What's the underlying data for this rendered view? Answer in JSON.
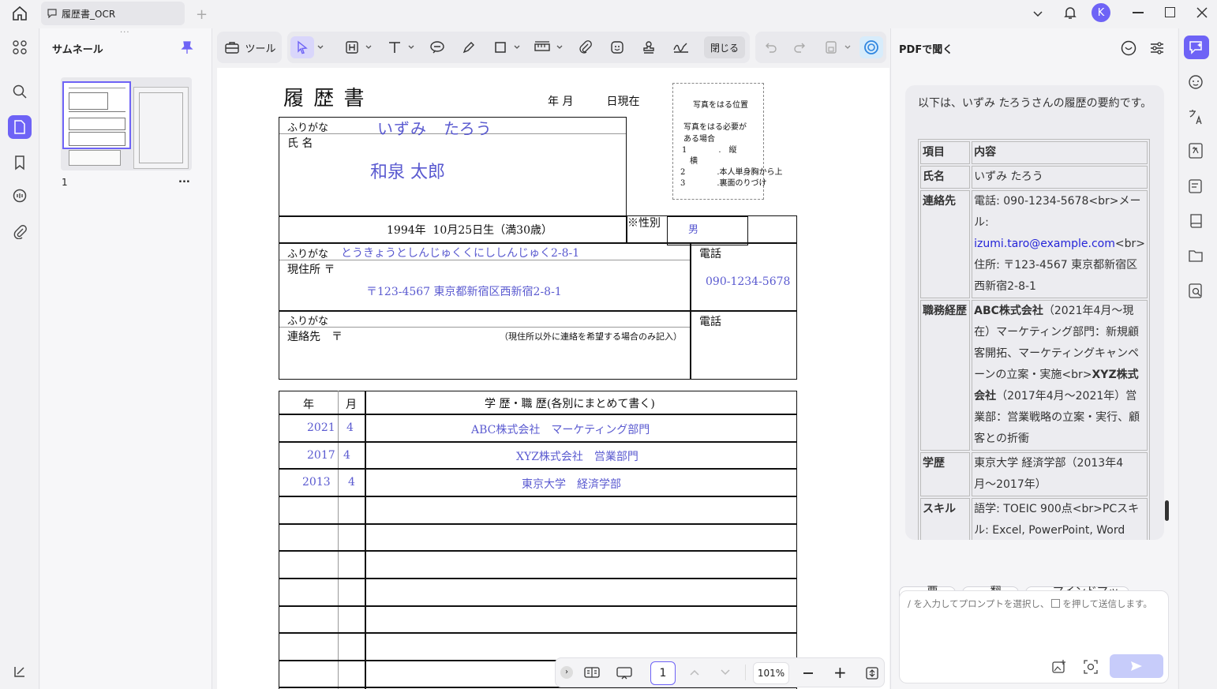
{
  "window": {
    "tab_title": "履歴書_OCR",
    "user_initial": "K",
    "accent": "#6e63f6"
  },
  "thumbnails": {
    "title": "サムネール",
    "page_number": "1",
    "more": "..."
  },
  "toolbar": {
    "tools_label": "ツール",
    "close_label": "閉じる"
  },
  "document": {
    "title": "履 歴 書",
    "date_label": "年 月　　　日現在",
    "photo": {
      "line1": "写真をはる位置",
      "line2": "写真をはる必要が",
      "line3": "ある場合",
      "line4": "1　　　　.　縦",
      "line5": "　横",
      "line6": "2　　　　.本人単身胸から上",
      "line7": "3　　　　.裏面のりづけ"
    },
    "furigana_label": "ふりがな",
    "furigana_name": "いずみ　たろう",
    "name_label": "氏 名",
    "name": "和泉 太郎",
    "birth": "1994年  10月25日生（満30歳）",
    "gender_label": "※性別",
    "gender": "男",
    "address_furigana_label": "ふりがな",
    "address_furigana": "とうきょうとしんじゅくくにししんじゅく2-8-1",
    "address_label": "現住所 〒",
    "address": "〒123-4567 東京都新宿区西新宿2-8-1",
    "phone_label": "電話",
    "phone": "090-1234-5678",
    "contact_furigana_label": "ふりがな",
    "contact_label": "連絡先　〒",
    "contact_note": "（現住所以外に連絡を希望する場合のみ記入）",
    "contact_phone_label": "電話",
    "history_header": {
      "year": "年",
      "month": "月",
      "content": "学 歴・職 歴(各別にまとめて書く)"
    },
    "history_rows": [
      {
        "year": "2021",
        "month": "4",
        "content": "ABC株式会社　マーケティング部門"
      },
      {
        "year": "2017",
        "month": "4",
        "content": "XYZ株式会社　営業部門"
      },
      {
        "year": "2013",
        "month": "4",
        "content": "東京大学　経済学部"
      }
    ]
  },
  "bottom_bar": {
    "page": "1",
    "zoom": "101%"
  },
  "ai_panel": {
    "title": "PDFで聞く",
    "intro": "以下は、いずみ たろうさんの履歴の要約です。",
    "summary_table": {
      "header": {
        "key": "項目",
        "value": "内容"
      },
      "rows": [
        {
          "key": "氏名",
          "value": "いずみ たろう"
        },
        {
          "key": "連絡先",
          "value_pre": "電話: 090-1234-5678<br>メール: ",
          "email": "izumi.taro@example.com",
          "value_post": "<br>住所: 〒123-4567 東京都新宿区西新宿2-8-1"
        },
        {
          "key": "職務経歴",
          "b1": "ABC株式会社",
          "t1": "（2021年4月〜現在）マーケティング部門：新規顧客開拓、マーケティングキャンペーンの立案・実施<br>",
          "b2": "XYZ株式会社",
          "t2": "（2017年4月〜2021年）営業部：営業戦略の立案・実行、顧客との折衝"
        },
        {
          "key": "学歴",
          "value": "東京大学 経済学部（2013年4月〜2017年）"
        },
        {
          "key": "スキル",
          "value": "語学: TOEIC 900点<br>PCスキル: Excel, PowerPoint, Word"
        }
      ]
    },
    "actions": {
      "summarize": "要約",
      "translate": "翻訳",
      "mindmap": "マインドマップ"
    },
    "prompt_placeholder_a": "/ を入力してプロンプトを選択し、",
    "prompt_placeholder_b": "を押して送信します。"
  }
}
